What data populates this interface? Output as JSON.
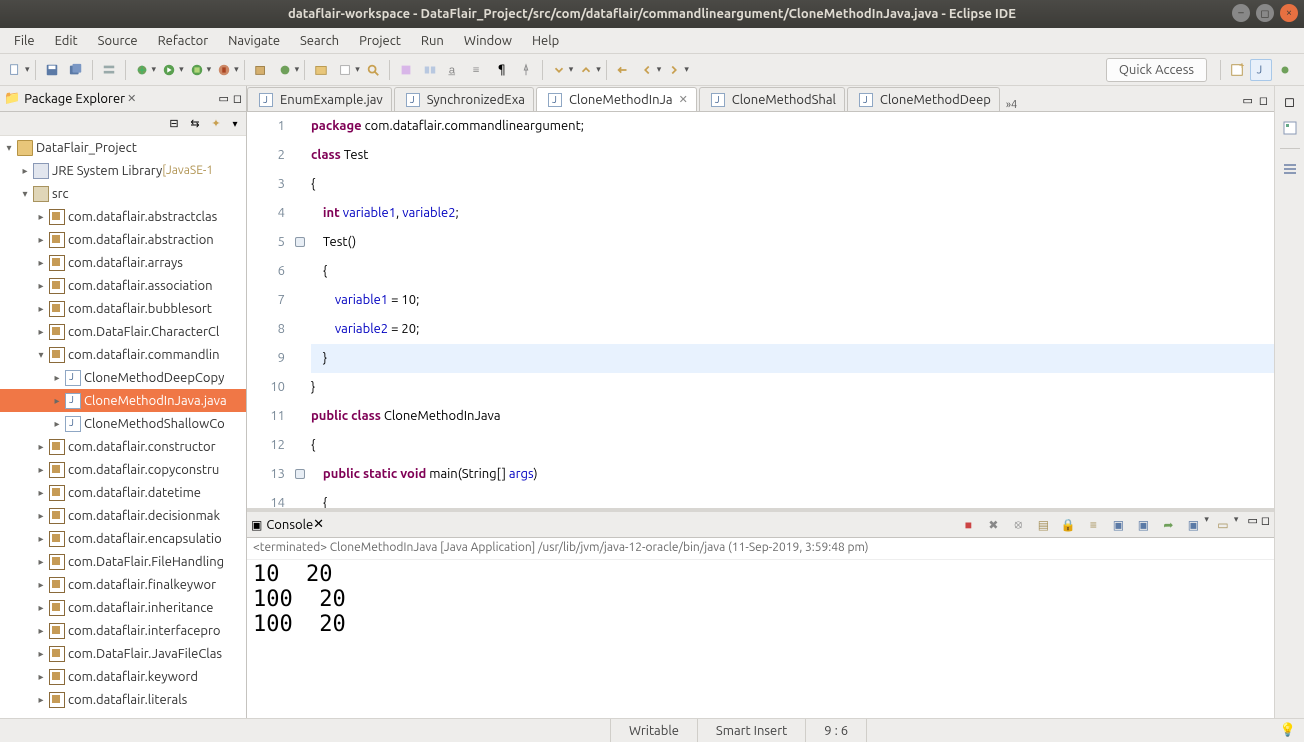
{
  "window": {
    "title": "dataflair-workspace - DataFlair_Project/src/com/dataflair/commandlineargument/CloneMethodInJava.java - Eclipse IDE"
  },
  "menu": [
    "File",
    "Edit",
    "Source",
    "Refactor",
    "Navigate",
    "Search",
    "Project",
    "Run",
    "Window",
    "Help"
  ],
  "quick_access": "Quick Access",
  "package_explorer": {
    "title": "Package Explorer",
    "project": "DataFlair_Project",
    "jre": "JRE System Library",
    "jre_suffix": "[JavaSE-1",
    "src": "src",
    "packages": [
      "com.dataflair.abstractclas",
      "com.dataflair.abstraction",
      "com.dataflair.arrays",
      "com.dataflair.association",
      "com.dataflair.bubblesort",
      "com.DataFlair.CharacterCl",
      "com.dataflair.commandlin"
    ],
    "cmd_children": [
      "CloneMethodDeepCopy",
      "CloneMethodInJava.java",
      "CloneMethodShallowCo"
    ],
    "packages2": [
      "com.dataflair.constructor",
      "com.dataflair.copyconstru",
      "com.dataflair.datetime",
      "com.dataflair.decisionmak",
      "com.dataflair.encapsulatio",
      "com.DataFlair.FileHandling",
      "com.dataflair.finalkeywor",
      "com.dataflair.inheritance",
      "com.dataflair.interfacepro",
      "com.DataFlair.JavaFileClas",
      "com.dataflair.keyword",
      "com.dataflair.literals"
    ]
  },
  "editor_tabs": [
    {
      "label": "EnumExample.jav",
      "active": false
    },
    {
      "label": "SynchronizedExa",
      "active": false
    },
    {
      "label": "CloneMethodInJa",
      "active": true
    },
    {
      "label": "CloneMethodShal",
      "active": false
    },
    {
      "label": "CloneMethodDeep",
      "active": false
    }
  ],
  "editor_more": "»4",
  "code_lines": {
    "1": {
      "pre": "",
      "tokens": [
        {
          "t": "package",
          "c": "kw"
        },
        {
          "t": " com.dataflair.commandlineargument;",
          "c": ""
        }
      ]
    },
    "2": {
      "pre": "",
      "tokens": [
        {
          "t": "class",
          "c": "kw"
        },
        {
          "t": " Test",
          "c": ""
        }
      ]
    },
    "3": {
      "pre": "",
      "tokens": [
        {
          "t": "{",
          "c": ""
        }
      ]
    },
    "4": {
      "pre": "    ",
      "tokens": [
        {
          "t": "int",
          "c": "kw"
        },
        {
          "t": " ",
          "c": ""
        },
        {
          "t": "variable1",
          "c": "fld"
        },
        {
          "t": ", ",
          "c": ""
        },
        {
          "t": "variable2",
          "c": "fld"
        },
        {
          "t": ";",
          "c": ""
        }
      ]
    },
    "5": {
      "pre": "    ",
      "tokens": [
        {
          "t": "Test()",
          "c": ""
        }
      ]
    },
    "6": {
      "pre": "    ",
      "tokens": [
        {
          "t": "{",
          "c": ""
        }
      ]
    },
    "7": {
      "pre": "        ",
      "tokens": [
        {
          "t": "variable1",
          "c": "fld"
        },
        {
          "t": " = 10;",
          "c": ""
        }
      ]
    },
    "8": {
      "pre": "        ",
      "tokens": [
        {
          "t": "variable2",
          "c": "fld"
        },
        {
          "t": " = 20;",
          "c": ""
        }
      ]
    },
    "9": {
      "pre": "    ",
      "tokens": [
        {
          "t": "}",
          "c": ""
        }
      ],
      "hl": true
    },
    "10": {
      "pre": "",
      "tokens": [
        {
          "t": "}",
          "c": ""
        }
      ]
    },
    "11": {
      "pre": "",
      "tokens": [
        {
          "t": "public",
          "c": "kw"
        },
        {
          "t": " ",
          "c": ""
        },
        {
          "t": "class",
          "c": "kw"
        },
        {
          "t": " CloneMethodInJava",
          "c": ""
        }
      ]
    },
    "12": {
      "pre": "",
      "tokens": [
        {
          "t": "{",
          "c": ""
        }
      ]
    },
    "13": {
      "pre": "    ",
      "tokens": [
        {
          "t": "public",
          "c": "kw"
        },
        {
          "t": " ",
          "c": ""
        },
        {
          "t": "static",
          "c": "kw"
        },
        {
          "t": " ",
          "c": ""
        },
        {
          "t": "void",
          "c": "kw"
        },
        {
          "t": " main(String[] ",
          "c": ""
        },
        {
          "t": "args",
          "c": "fld"
        },
        {
          "t": ")",
          "c": ""
        }
      ]
    },
    "14": {
      "pre": "    ",
      "tokens": [
        {
          "t": "{",
          "c": ""
        }
      ]
    }
  },
  "annotations": {
    "5": true,
    "13": true
  },
  "console": {
    "title": "Console",
    "info": "<terminated> CloneMethodInJava [Java Application] /usr/lib/jvm/java-12-oracle/bin/java (11-Sep-2019, 3:59:48 pm)",
    "out": "10  20\n100  20\n100  20"
  },
  "status": {
    "writable": "Writable",
    "insert": "Smart Insert",
    "pos": "9 : 6"
  }
}
